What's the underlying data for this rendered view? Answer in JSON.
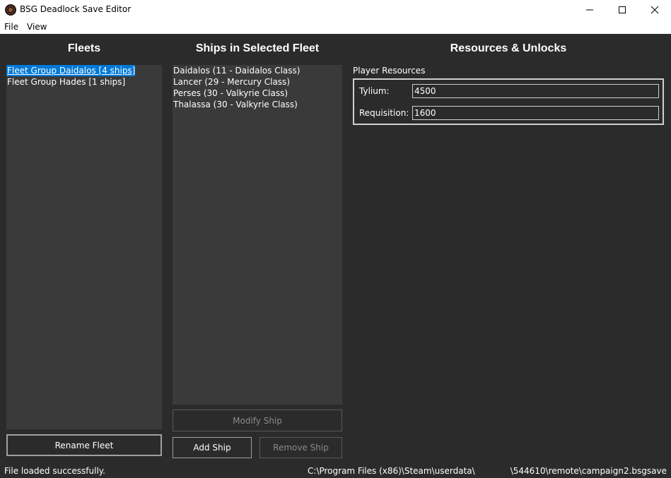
{
  "window": {
    "title": "BSG Deadlock Save Editor",
    "minimize_icon": "minimize-icon",
    "maximize_icon": "maximize-icon",
    "close_icon": "close-icon"
  },
  "menu": {
    "items": [
      "File",
      "View"
    ]
  },
  "fleets": {
    "heading": "Fleets",
    "items": [
      {
        "label": "Fleet Group Daidalos [4 ships]",
        "selected": true
      },
      {
        "label": "Fleet Group Hades [1 ships]",
        "selected": false
      }
    ],
    "rename_button": "Rename Fleet"
  },
  "ships": {
    "heading": "Ships in Selected Fleet",
    "items": [
      "Daidalos (11 - Daidalos Class)",
      "Lancer (29 - Mercury Class)",
      "Perses (30 - Valkyrie Class)",
      "Thalassa (30 - Valkyrie Class)"
    ],
    "modify_button": "Modify Ship",
    "add_button": "Add Ship",
    "remove_button": "Remove Ship"
  },
  "resources": {
    "heading": "Resources & Unlocks",
    "group_label": "Player Resources",
    "tylium_label": "Tylium:",
    "tylium_value": "4500",
    "requisition_label": "Requisition:",
    "requisition_value": "1600"
  },
  "status": {
    "message": "File loaded successfully.",
    "path_prefix": "C:\\Program Files (x86)\\Steam\\userdata\\",
    "path_suffix": "\\544610\\remote\\campaign2.bsgsave"
  },
  "colors": {
    "background": "#2b2b2b",
    "list_background": "#3a3a3a",
    "selection": "#0078d7"
  }
}
